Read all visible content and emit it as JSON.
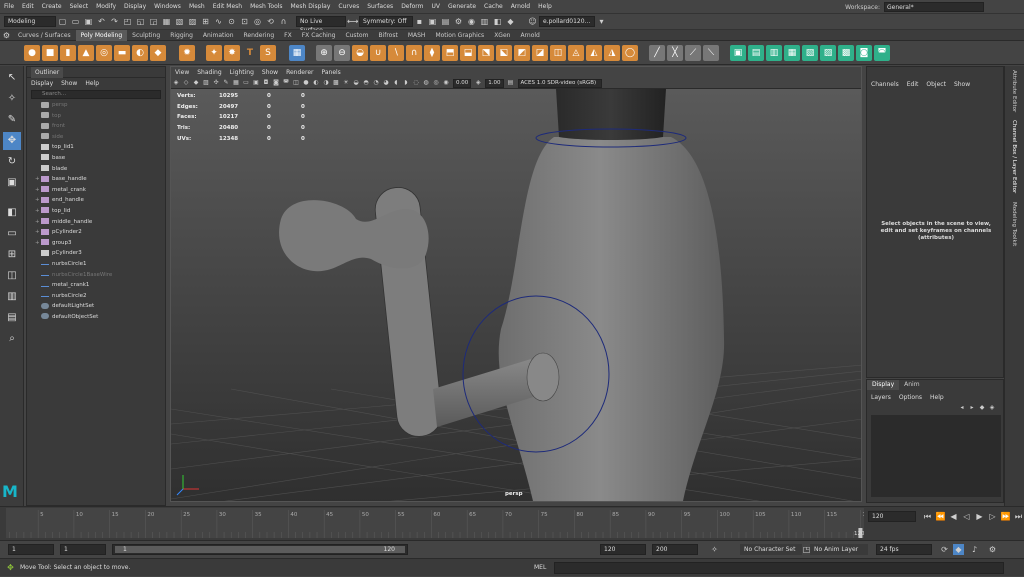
{
  "menubar": {
    "items": [
      "File",
      "Edit",
      "Create",
      "Select",
      "Modify",
      "Display",
      "Windows",
      "Mesh",
      "Edit Mesh",
      "Mesh Tools",
      "Mesh Display",
      "Curves",
      "Surfaces",
      "Deform",
      "UV",
      "Generate",
      "Cache",
      "Arnold",
      "Help"
    ],
    "workspace_label": "Workspace:",
    "workspace_value": "General*"
  },
  "statusline": {
    "mode": "Modeling",
    "live_surface": "No Live Surface",
    "symmetry": "Symmetry: Off",
    "user": "e.pollard0120..."
  },
  "shelf_tabs": [
    "Curves / Surfaces",
    "Poly Modeling",
    "Sculpting",
    "Rigging",
    "Animation",
    "Rendering",
    "FX",
    "FX Caching",
    "Custom",
    "Bifrost",
    "MASH",
    "Motion Graphics",
    "XGen",
    "Arnold"
  ],
  "shelf_active_tab": "Poly Modeling",
  "outliner": {
    "title": "Outliner",
    "menus": [
      "Display",
      "Show",
      "Help"
    ],
    "search_placeholder": "Search...",
    "items": [
      {
        "name": "persp",
        "type": "cam",
        "dim": true,
        "expand": ""
      },
      {
        "name": "top",
        "type": "cam",
        "dim": true,
        "expand": ""
      },
      {
        "name": "front",
        "type": "cam",
        "dim": true,
        "expand": ""
      },
      {
        "name": "side",
        "type": "cam",
        "dim": true,
        "expand": ""
      },
      {
        "name": "top_lid1",
        "type": "mesh",
        "dim": false,
        "expand": ""
      },
      {
        "name": "base",
        "type": "mesh",
        "dim": false,
        "expand": ""
      },
      {
        "name": "blade",
        "type": "mesh",
        "dim": false,
        "expand": ""
      },
      {
        "name": "base_handle",
        "type": "grp",
        "dim": false,
        "expand": "+"
      },
      {
        "name": "metal_crank",
        "type": "grp",
        "dim": false,
        "expand": "+"
      },
      {
        "name": "end_handle",
        "type": "grp",
        "dim": false,
        "expand": "+"
      },
      {
        "name": "top_lid",
        "type": "grp",
        "dim": false,
        "expand": "+"
      },
      {
        "name": "middle_handle",
        "type": "grp",
        "dim": false,
        "expand": "+"
      },
      {
        "name": "pCylinder2",
        "type": "grp",
        "dim": false,
        "expand": "+"
      },
      {
        "name": "group3",
        "type": "grp",
        "dim": false,
        "expand": "+"
      },
      {
        "name": "pCylinder3",
        "type": "mesh",
        "dim": false,
        "expand": ""
      },
      {
        "name": "nurbsCircle1",
        "type": "curve",
        "dim": false,
        "expand": ""
      },
      {
        "name": "nurbsCircle1BaseWire",
        "type": "curve",
        "dim": true,
        "expand": ""
      },
      {
        "name": "metal_crank1",
        "type": "curve",
        "dim": false,
        "expand": ""
      },
      {
        "name": "nurbsCircle2",
        "type": "curve",
        "dim": false,
        "expand": ""
      },
      {
        "name": "defaultLightSet",
        "type": "set",
        "dim": false,
        "expand": ""
      },
      {
        "name": "defaultObjectSet",
        "type": "set",
        "dim": false,
        "expand": ""
      }
    ]
  },
  "viewport": {
    "menus": [
      "View",
      "Shading",
      "Lighting",
      "Show",
      "Renderer",
      "Panels"
    ],
    "near_value": "0.00",
    "gamma_value": "1.00",
    "color_space": "ACES 1.0 SDR-video (sRGB)",
    "hud": [
      {
        "label": "Verts:",
        "value": "10295",
        "a": "0",
        "b": "0"
      },
      {
        "label": "Edges:",
        "value": "20497",
        "a": "0",
        "b": "0"
      },
      {
        "label": "Faces:",
        "value": "10217",
        "a": "0",
        "b": "0"
      },
      {
        "label": "Tris:",
        "value": "20480",
        "a": "0",
        "b": "0"
      },
      {
        "label": "UVs:",
        "value": "12348",
        "a": "0",
        "b": "0"
      }
    ],
    "camera": "persp"
  },
  "channelbox": {
    "menus": [
      "Channels",
      "Edit",
      "Object",
      "Show"
    ],
    "message": "Select objects in the scene to view, edit and set keyframes on channels (attributes)"
  },
  "sidetabs": [
    "Attribute Editor",
    "Channel Box / Layer Editor",
    "Modeling Toolkit"
  ],
  "layers": {
    "tabs": [
      "Display",
      "Anim"
    ],
    "menus": [
      "Layers",
      "Options",
      "Help"
    ]
  },
  "timeline": {
    "ticks": [
      "5",
      "10",
      "15",
      "20",
      "25",
      "30",
      "35",
      "40",
      "45",
      "50",
      "55",
      "60",
      "65",
      "70",
      "75",
      "80",
      "85",
      "90",
      "95",
      "100",
      "105",
      "110",
      "115",
      "120"
    ],
    "end_label": "120",
    "current_frame": "120"
  },
  "range": {
    "start": "1",
    "inner_start": "1",
    "slider_start": "1",
    "slider_end": "120",
    "end": "120",
    "max": "200",
    "character_set": "No Character Set",
    "anim_layer": "No Anim Layer",
    "fps": "24 fps"
  },
  "helpline": {
    "message": "Move Tool: Select an object to move.",
    "mel": "MEL"
  }
}
